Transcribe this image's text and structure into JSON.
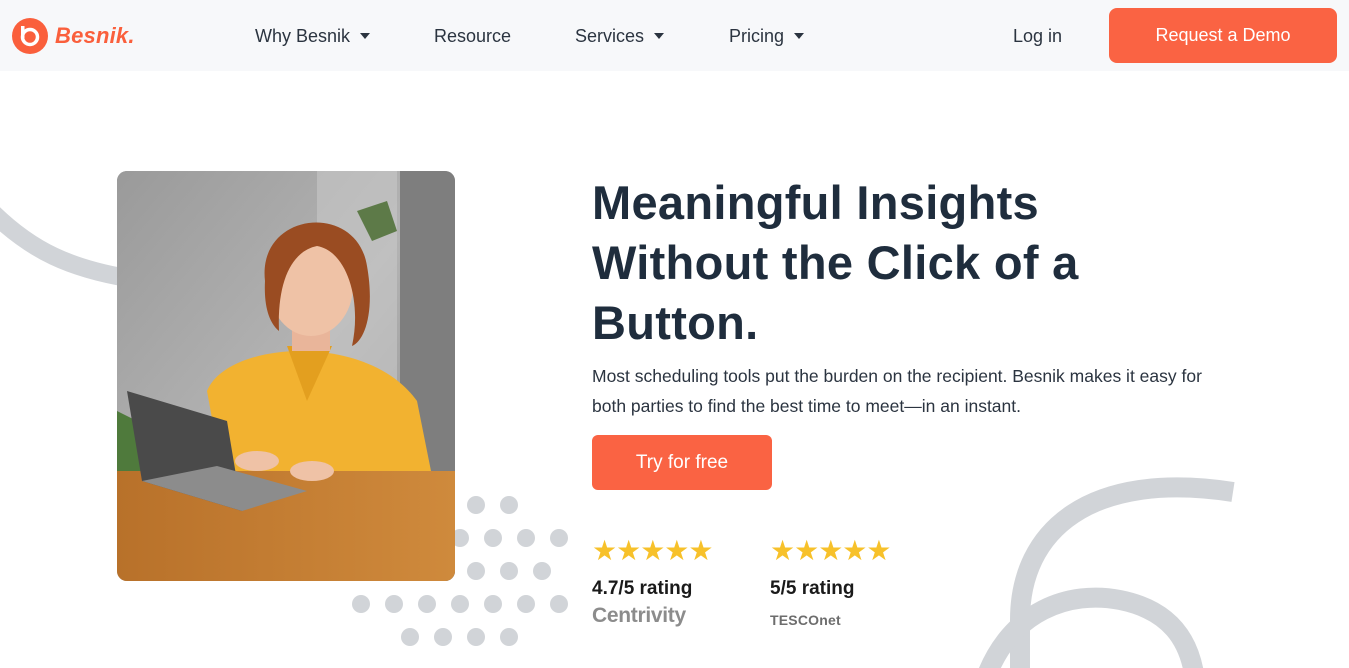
{
  "brand": {
    "name": "Besnik.",
    "accent": "#fa5f3c"
  },
  "nav": {
    "items": [
      {
        "label": "Why Besnik",
        "has_dropdown": true
      },
      {
        "label": "Resource",
        "has_dropdown": false
      },
      {
        "label": "Services",
        "has_dropdown": true
      },
      {
        "label": "Pricing",
        "has_dropdown": true
      }
    ],
    "login_label": "Log in",
    "demo_label": "Request a Demo"
  },
  "hero": {
    "headline": "Meaningful Insights Without the Click of a Button.",
    "subtext": "Most scheduling tools put the burden on the recipient. Besnik makes it easy for both parties to find the best time to meet—in an instant.",
    "cta_label": "Try for free",
    "ratings": [
      {
        "stars": "★★★★★",
        "text": "4.7/5 rating",
        "source": "Centrivity"
      },
      {
        "stars": "★★★★★",
        "text": "5/5 rating",
        "source": "TESCOnet"
      }
    ]
  },
  "colors": {
    "button": "#fa6343",
    "heading": "#1f2d3d",
    "star": "#f7c12a",
    "decor": "#d1d4d8"
  },
  "icons": [
    "besnik-logo-icon",
    "chevron-down-icon",
    "star-icon"
  ]
}
